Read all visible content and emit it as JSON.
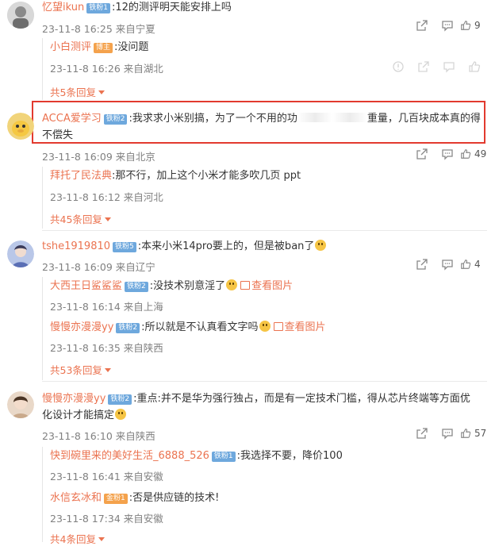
{
  "comments": [
    {
      "username": "忆望ikun",
      "badge": "铁粉1",
      "text": ":12的测评明天能安排上吗",
      "time": "23-11-8 16:25 来自宁夏",
      "likes": "9",
      "replies": [
        {
          "username": "小白测评",
          "badge": "博主",
          "text": ":没问题",
          "time": "23-11-8 16:26 来自湖北"
        }
      ],
      "more": "共5条回复"
    },
    {
      "username": "ACCA爱学习",
      "badge": "铁粉2",
      "text_part1": ":我求求小米别搞，为了一个不用的功",
      "text_part2": "重量，几百块成本真的得",
      "text_line2": "不偿失",
      "time": "23-11-8 16:09 来自北京",
      "likes": "49",
      "replies": [
        {
          "username": "拜托了民法典",
          "text": ":那不行，加上这个小米才能多吹几页 ppt",
          "time": "23-11-8 16:12 来自河北"
        }
      ],
      "more": "共45条回复"
    },
    {
      "username": "tshe1919810",
      "badge": "铁粉5",
      "text": ":本来小米14pro要上的，但是被ban了",
      "time": "23-11-8 16:09 来自辽宁",
      "likes": "4",
      "replies": [
        {
          "username": "大西王日鲨鲨鲨",
          "badge": "铁粉2",
          "text": ":没技术别意淫了",
          "pic": "查看图片",
          "time": "23-11-8 16:14 来自上海"
        },
        {
          "username": "慢慢亦漫漫yy",
          "badge": "铁粉2",
          "text": ":所以就是不认真看文字吗",
          "pic": "查看图片",
          "time": "23-11-8 16:35 来自陕西"
        }
      ],
      "more": "共53条回复"
    },
    {
      "username": "慢慢亦漫漫yy",
      "badge": "铁粉2",
      "text": ":重点:并不是华为强行独占，而是有一定技术门槛，得从芯片终端等方面优",
      "text_line2": "化设计才能搞定",
      "time": "23-11-8 16:10 来自陕西",
      "likes": "57",
      "replies": [
        {
          "username": "快到碗里来的美好生活_6888_526",
          "badge": "铁粉1",
          "text": ":我选择不要，降价100",
          "time": "23-11-8 16:41 来自安徽"
        },
        {
          "username": "水信玄冰和",
          "badge": "金粉1",
          "text": ":否是供应链的技术!",
          "time": "23-11-8 17:34 来自安徽"
        }
      ],
      "more": "共4条回复"
    }
  ],
  "colors": {
    "accent": "#eb7350",
    "highlight": "#e23a2f",
    "badge_blue": "#6ea8dd",
    "badge_gold": "#f4a24c"
  },
  "icons": [
    "share-icon",
    "comment-icon",
    "like-icon",
    "report-icon"
  ]
}
